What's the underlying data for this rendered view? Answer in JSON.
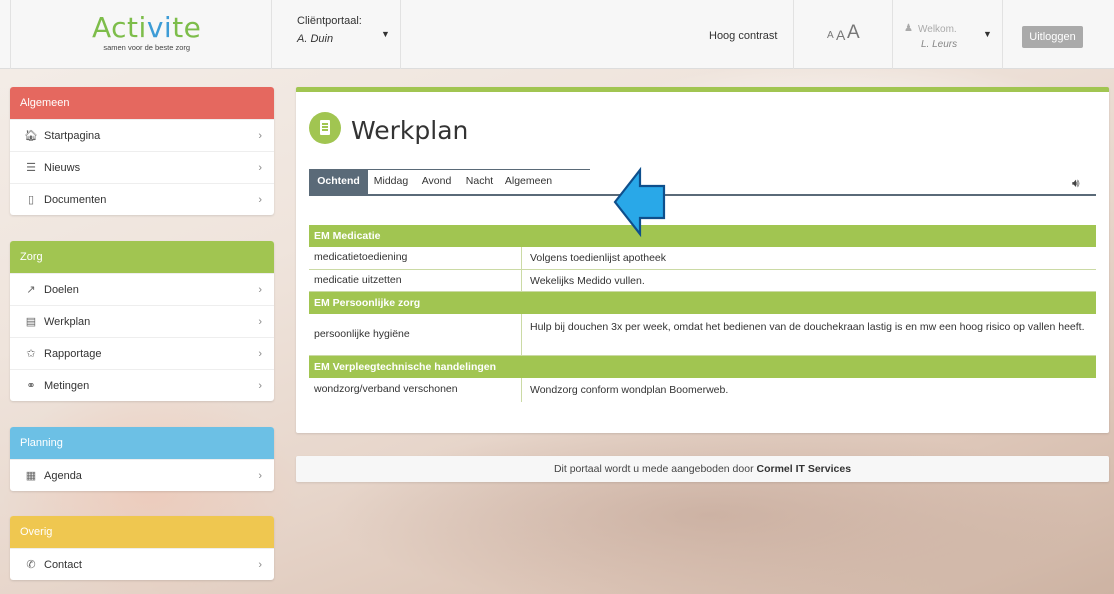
{
  "header": {
    "logo_text_part1": "Acti",
    "logo_text_part2": "vi",
    "logo_text_part3": "te",
    "logo_tagline": "samen voor de beste zorg",
    "client_label": "Cliëntportaal:",
    "client_name": "A. Duin",
    "contrast_label": "Hoog contrast",
    "font_size_small": "A",
    "font_size_medium": "A",
    "font_size_large": "A",
    "welcome_label": "Welkom.",
    "user_name": "L. Leurs",
    "logout_label": "Uitloggen"
  },
  "sidebar": {
    "sections": [
      {
        "title": "Algemeen",
        "color": "#e5685f",
        "items": [
          {
            "label": "Startpagina",
            "icon": "home-icon"
          },
          {
            "label": "Nieuws",
            "icon": "news-icon"
          },
          {
            "label": "Documenten",
            "icon": "document-icon"
          }
        ]
      },
      {
        "title": "Zorg",
        "color": "#a1c551",
        "items": [
          {
            "label": "Doelen",
            "icon": "goals-icon"
          },
          {
            "label": "Werkplan",
            "icon": "workplan-icon"
          },
          {
            "label": "Rapportage",
            "icon": "report-icon"
          },
          {
            "label": "Metingen",
            "icon": "gauge-icon"
          }
        ]
      },
      {
        "title": "Planning",
        "color": "#6cc0e5",
        "items": [
          {
            "label": "Agenda",
            "icon": "calendar-icon"
          }
        ]
      },
      {
        "title": "Overig",
        "color": "#efc750",
        "items": [
          {
            "label": "Contact",
            "icon": "phone-icon"
          }
        ]
      }
    ]
  },
  "main": {
    "title": "Werkplan",
    "tabs": [
      "Ochtend",
      "Middag",
      "Avond",
      "Nacht",
      "Algemeen"
    ],
    "active_tab": "Ochtend",
    "sections": [
      {
        "title": "EM Medicatie",
        "rows": [
          {
            "name": "medicatietoediening",
            "value": "Volgens toedienlijst apotheek"
          },
          {
            "name": "medicatie uitzetten",
            "value": "Wekelijks Medido vullen."
          }
        ]
      },
      {
        "title": "EM Persoonlijke zorg",
        "rows": [
          {
            "name": "persoonlijke hygiëne",
            "value": "Hulp bij douchen 3x per week, omdat het bedienen van de douchekraan lastig is en mw een hoog risico op vallen heeft."
          }
        ]
      },
      {
        "title": "EM Verpleegtechnische handelingen",
        "rows": [
          {
            "name": "wondzorg/verband verschonen",
            "value": "Wondzorg conform wondplan Boomerweb."
          }
        ]
      }
    ]
  },
  "footer": {
    "text": "Dit portaal wordt u mede aangeboden door",
    "company": "Cormel IT Services"
  },
  "colors": {
    "accent_green": "#a1c551",
    "tab_active": "#5a6a78",
    "arrow_blue": "#29a8e8"
  }
}
